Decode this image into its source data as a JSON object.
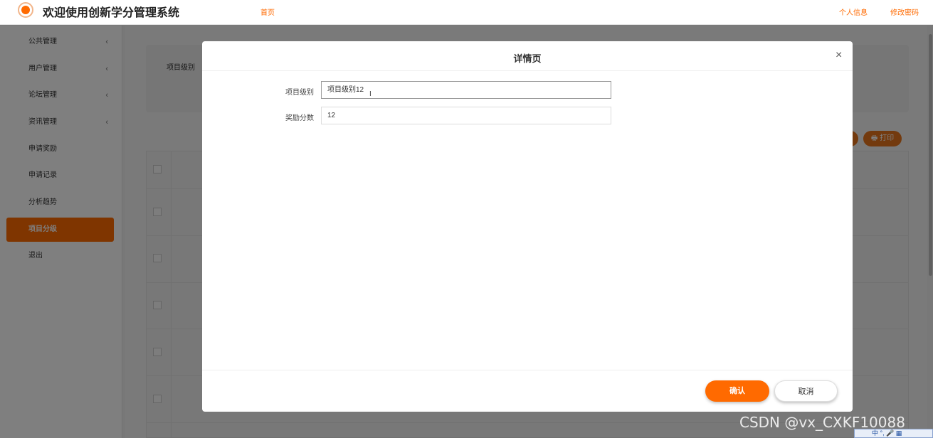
{
  "header": {
    "title": "欢迎使用创新学分管理系统",
    "nav_home": "首页",
    "nav_profile": "个人信息",
    "nav_password": "修改密码"
  },
  "sidebar": {
    "items": [
      {
        "label": "公共管理",
        "chevron": "‹"
      },
      {
        "label": "用户管理",
        "chevron": "‹"
      },
      {
        "label": "论坛管理",
        "chevron": "‹"
      },
      {
        "label": "资讯管理",
        "chevron": "‹"
      },
      {
        "label": "申请奖励"
      },
      {
        "label": "申请记录"
      },
      {
        "label": "分析趋势"
      },
      {
        "label": "项目分级"
      },
      {
        "label": "退出"
      }
    ],
    "active_index": 7
  },
  "background": {
    "filter_label": "项目级别",
    "print_label": "🖶 打印"
  },
  "modal": {
    "title": "详情页",
    "close": "×",
    "fields": [
      {
        "label": "项目级别",
        "value": "项目级别12"
      },
      {
        "label": "奖励分数",
        "value": "12"
      }
    ],
    "confirm_label": "确认",
    "cancel_label": "取消"
  },
  "overlay_text": {
    "watermark": "CSDN @vx_CXKF10088",
    "ime": "中 °, 🎤 ▦"
  },
  "colors": {
    "accent": "#ff6a00",
    "active_sidebar": "#ff6a00"
  }
}
